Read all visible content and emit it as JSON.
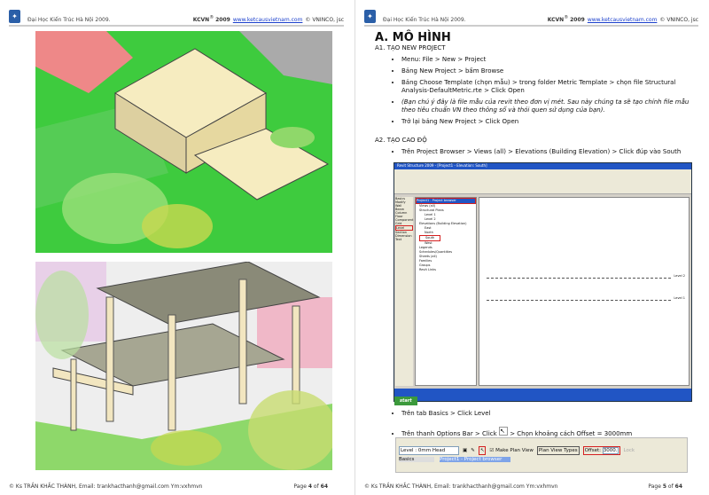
{
  "header": {
    "university": "Đại Học Kiến Trúc Hà Nội 2009.",
    "brand": "KCVN",
    "brand_sup": "®",
    "year": "2009",
    "website": "www.ketcausvietnam.com",
    "copyright": "© VNINCO, jsc"
  },
  "footer": {
    "author": "© Ks TRẦN KHẮC THÀNH, Email: trankhacthanh@gmail.com Ym:vxhmvn",
    "page_prefix": "Page",
    "page_of": "of",
    "total": "64"
  },
  "pages": [
    {
      "number": "4"
    },
    {
      "number": "5"
    }
  ],
  "content": {
    "title": "A. MÔ HÌNH",
    "s1": {
      "heading": "A1. TẠO NEW PROJECT",
      "items": [
        "Menu: File > New > Project",
        "Bảng New Project > bấm Browse",
        "Bảng Choose Template (chọn mẫu) > trong folder Metric Template > chọn file Structural Analysis-DefaultMetric.rte > Click Open",
        "(Bạn chú ý đây là file mẫu của revit theo đơn vị mét. Sau này chúng ta sẽ tạo chính file mẫu theo tiêu chuẩn VN theo thông số và thói quen sử dụng của bạn).",
        "Trở lại bảng New Project > Click Open"
      ]
    },
    "s2": {
      "heading": "A2. TẠO CAO ĐỘ",
      "items": [
        "Trên Project Browser > Views (all) > Elevations (Building Elevation) > Click đúp vào South",
        "Trên tab Basics > Click Level",
        "Trên thanh Options Bar > Click",
        "> Chọn khoảng cách Offset = 3000mm"
      ]
    }
  },
  "revit": {
    "title": "Revit Structure 2009 - [Project1 - Elevation: South]",
    "browser_title": "Project1 - Project browser",
    "tree": [
      "Views (all)",
      "Structural Plans",
      "Level 1",
      "Level 2",
      "Elevations (Building Elevation)",
      "East",
      "North",
      "South",
      "West",
      "Legends",
      "Schedules/Quantities",
      "Sheets (all)",
      "Families",
      "Groups",
      "Revit Links"
    ],
    "basics_items": [
      "Basics",
      "Modify",
      "Wall",
      "Beam",
      "Column",
      "Floor",
      "Component",
      "Grid",
      "Level",
      "Section",
      "Dimension",
      "Text"
    ],
    "levels": [
      "Level 2",
      "Level 1"
    ],
    "start": "start"
  },
  "options_bar": {
    "level_select": "Level : 0mm Head",
    "make_plan_view": "Make Plan View",
    "plan_view_types": "Plan View Types",
    "offset_label": "Offset:",
    "offset_value": "3000.",
    "lock": "Lock",
    "basics": "Basics",
    "modify": "Modify",
    "browser": "Project1 - Project browser",
    "views": "Views (all)"
  },
  "colors": {
    "highlight": "#d42020",
    "xp_blue": "#2155c4",
    "grass": "#3ecb3e"
  }
}
